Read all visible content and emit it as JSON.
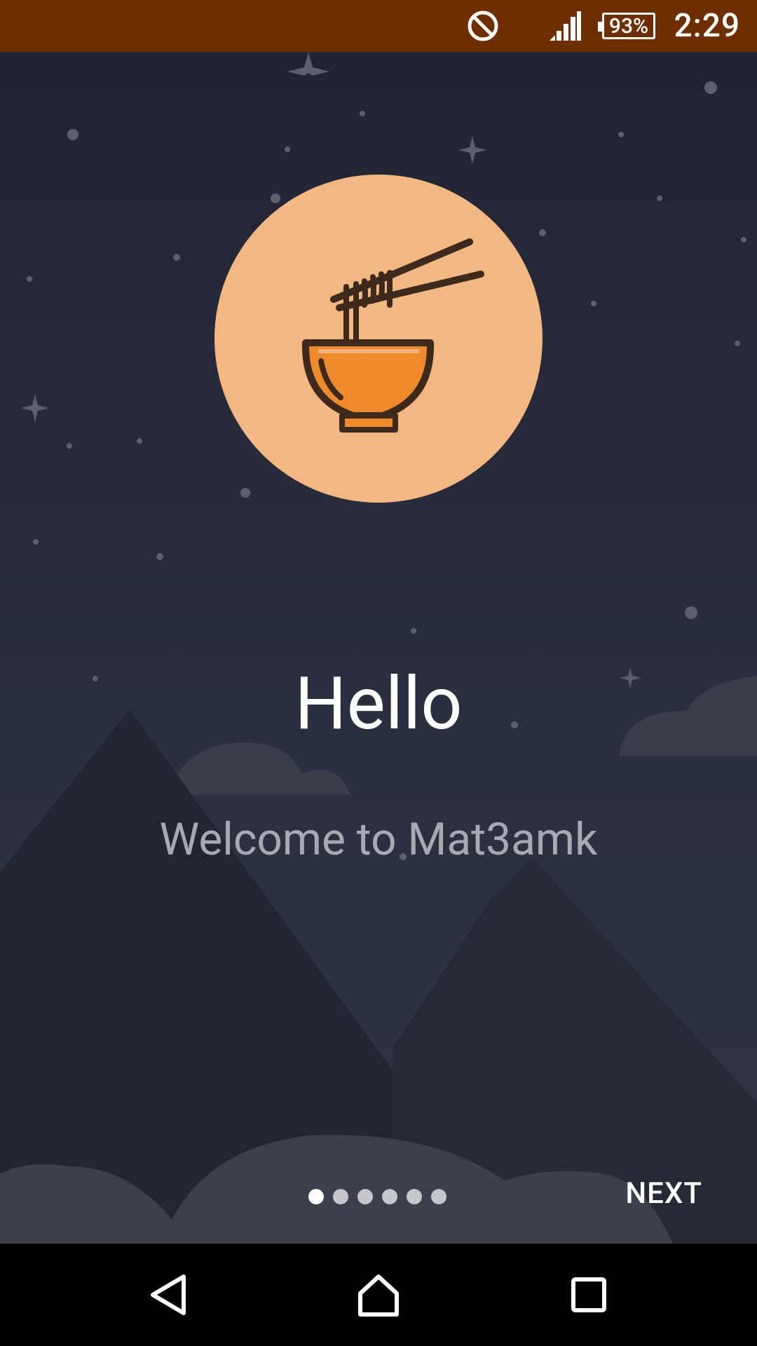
{
  "status_bar": {
    "time": "2:29",
    "battery_percent": "93%",
    "signal_icon": "cell-signal-icon",
    "dnd_icon": "do-not-disturb-icon",
    "background_color": "#6e2e00"
  },
  "onboarding": {
    "hero_icon": "noodle-bowl-icon",
    "title": "Hello",
    "subtitle": "Welcome to Mat3amk",
    "page_indicator": {
      "total_pages": 6,
      "current_page": 1
    },
    "next_label": "NEXT",
    "accent_color": "#f3b782"
  },
  "nav_bar": {
    "back_icon": "back-icon",
    "home_icon": "home-icon",
    "recents_icon": "recents-icon"
  }
}
